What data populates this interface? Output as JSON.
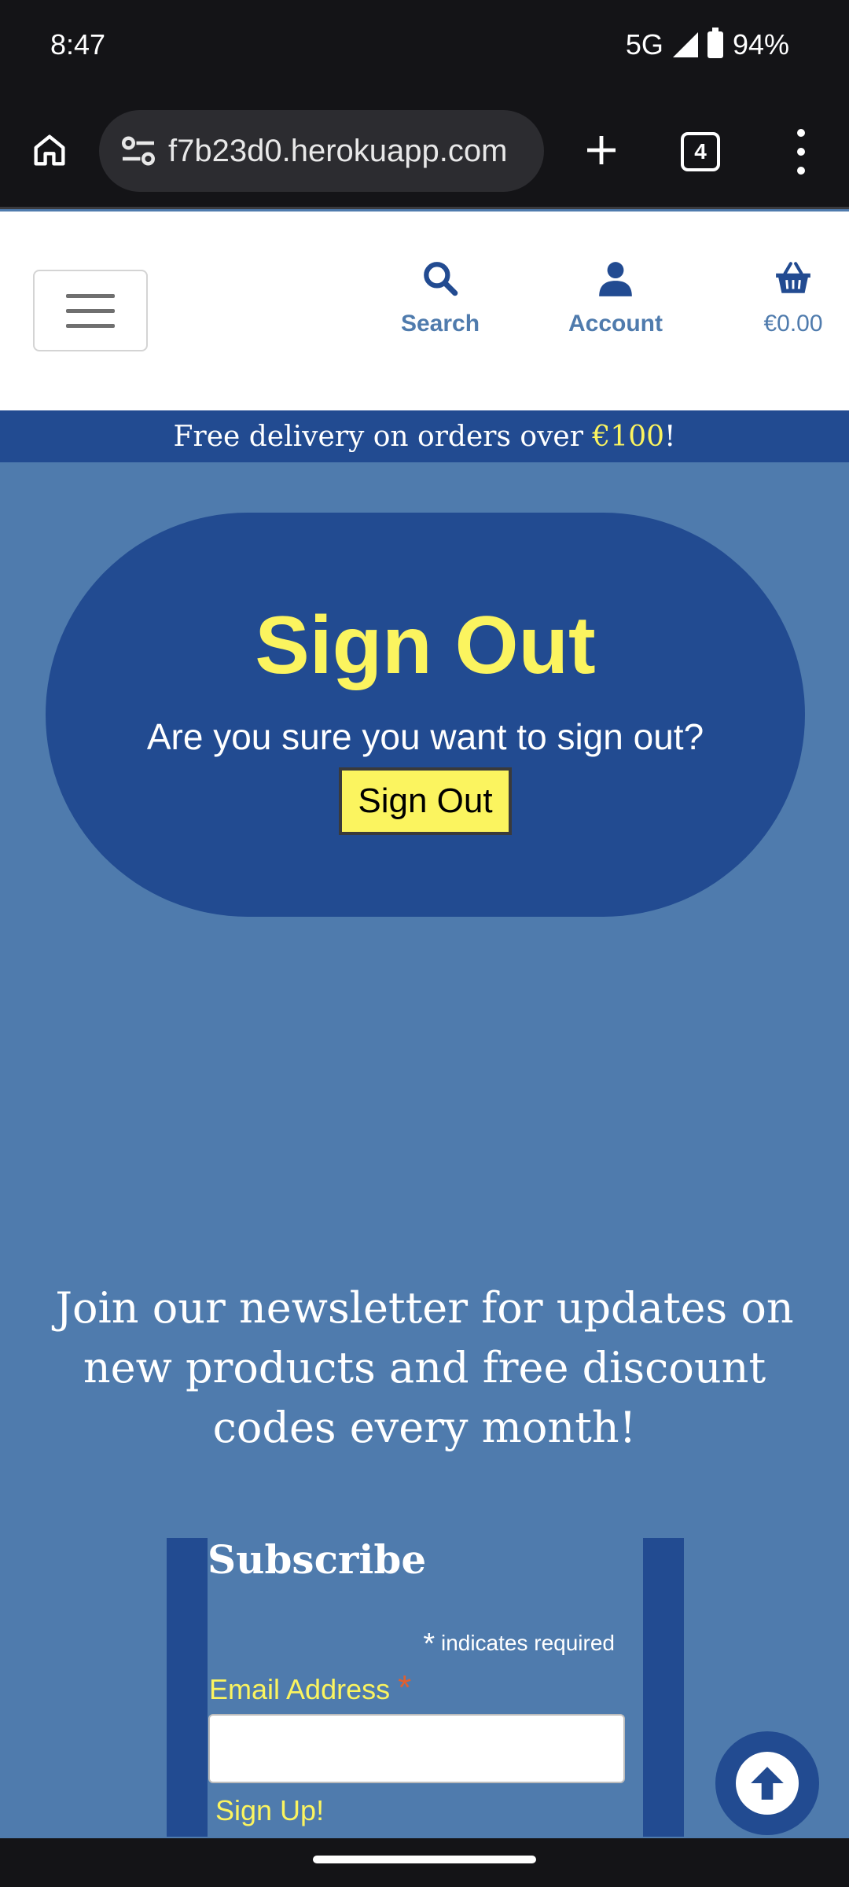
{
  "status_bar": {
    "time": "8:47",
    "network": "5G",
    "battery": "94%"
  },
  "browser": {
    "url": "f7b23d0.herokuapp.com",
    "tab_count": "4"
  },
  "header": {
    "search_label": "Search",
    "account_label": "Account",
    "bag_total": "€0.00",
    "accent_color": "#224b91"
  },
  "banner": {
    "text_before": "Free delivery on orders over ",
    "highlight": "€100",
    "text_after": "!"
  },
  "signout": {
    "title": "Sign Out",
    "question": "Are you sure you want to sign out?",
    "button_label": "Sign Out"
  },
  "newsletter": {
    "text": "Join our newsletter for updates on new products and free discount codes every month!",
    "subscribe_title": "Subscribe",
    "required_asterisk": "*",
    "required_note": "indicates required",
    "email_label": "Email Address",
    "email_required_mark": "*",
    "email_value": "",
    "signup_label": "Sign Up!"
  },
  "icons": {
    "home": "home-icon",
    "site_settings": "tune-icon",
    "new_tab": "plus-icon",
    "menu": "more-vert-icon",
    "search": "search-icon",
    "account": "user-icon",
    "bag": "basket-icon",
    "scroll_top": "arrow-up-icon"
  },
  "colors": {
    "yellow": "#fbf45f",
    "page_bg": "#4f7bad",
    "dark_blue": "#224b91"
  }
}
